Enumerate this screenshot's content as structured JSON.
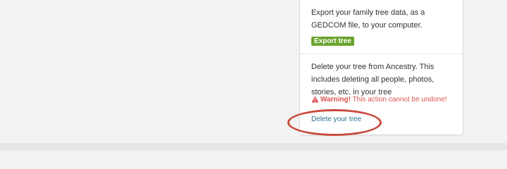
{
  "export_section": {
    "description": "Export your family tree data, as a GEDCOM file, to your computer.",
    "button_label": "Export tree"
  },
  "delete_section": {
    "description": "Delete your tree from Ancestry. This includes deleting all people, photos, stories, etc. in your tree",
    "warning_icon": "warning-triangle-icon",
    "warning_label": "Warning!",
    "warning_text": " This action cannot be undone!",
    "link_label": "Delete your tree"
  },
  "colors": {
    "page_background": "#f2f2f2",
    "export_button": "#6aa32b",
    "warning": "#d9534f",
    "link": "#2a6e8f",
    "annotation_ellipse": "#c84a3c"
  }
}
